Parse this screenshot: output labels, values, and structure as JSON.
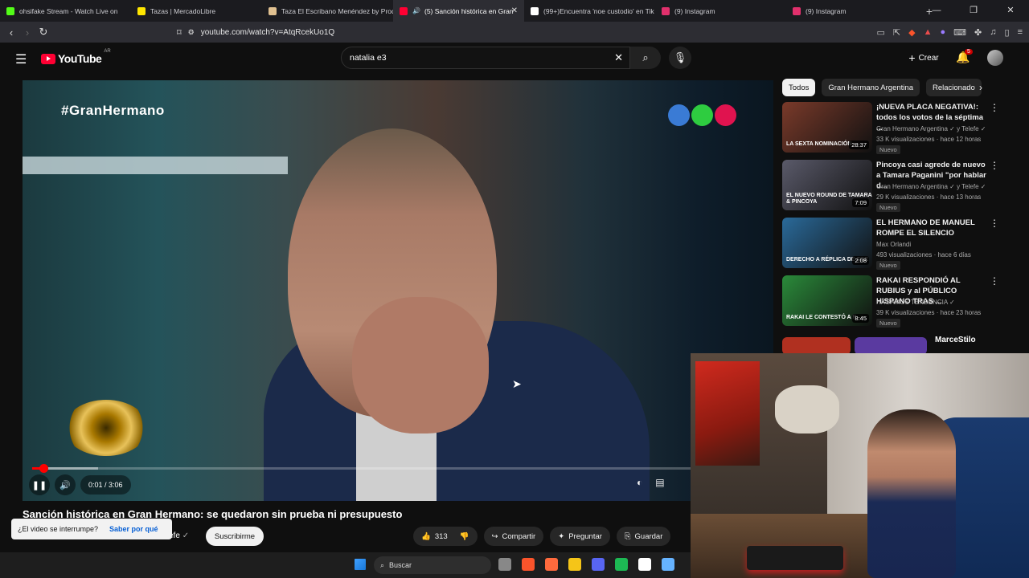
{
  "browser": {
    "tabs": [
      {
        "title": "ohsifake Stream - Watch Live on",
        "color": "#53fc18"
      },
      {
        "title": "Tazas | MercadoLibre",
        "color": "#ffe600"
      },
      {
        "title": "Taza El Escribano Menéndez by Prod",
        "color": "#e0c090"
      },
      {
        "title": "(5) Sanción histórica en Gran",
        "color": "#ff0033",
        "active": true
      },
      {
        "title": "(99+)Encuentra 'noe custodio' en Tik",
        "color": "#ffffff"
      },
      {
        "title": "(9) Instagram",
        "color": "#e1306c"
      },
      {
        "title": "(9) Instagram",
        "color": "#e1306c"
      }
    ],
    "new_tab": "+",
    "url": "youtube.com/watch?v=AtqRcekUo1Q"
  },
  "header": {
    "logo_text": "YouTube",
    "country": "AR",
    "search_value": "natalia e3",
    "create_label": "Crear",
    "notification_count": "5"
  },
  "player": {
    "overlay_tag": "#GranHermano",
    "time": "0:01 / 3:06",
    "progress_fraction": 0.01,
    "buffered_fraction": 0.09,
    "dot_colors": [
      "#3a7bd5",
      "#2ecc40",
      "#e0134f"
    ]
  },
  "video": {
    "title": "Sanción histórica en Gran Hermano: se quedaron sin prueba ni presupuesto",
    "channel_partial": "efe",
    "subscribe_label": "Suscribirme",
    "likes": "313",
    "share_label": "Compartir",
    "ask_label": "Preguntar",
    "save_label": "Guardar"
  },
  "toast": {
    "question": "¿El video se interrumpe?",
    "link": "Saber por qué"
  },
  "sidebar": {
    "chips": [
      "Todos",
      "Gran Hermano Argentina",
      "Relacionado"
    ],
    "recommendations": [
      {
        "title": "¡NUEVA PLACA NEGATIVA!: todos los votos de la séptima ...",
        "channel": "Gran Hermano Argentina ✓ y Telefe ✓",
        "meta": "33 K visualizaciones · hace 12 horas",
        "badge": "Nuevo",
        "duration": "28:37",
        "overlay": "LA SEXTA NOMINACIÓN",
        "thumb_color": "#7a3a2a"
      },
      {
        "title": "Pincoya casi agrede de nuevo a Tamara Paganini \"por hablar d...",
        "channel": "Gran Hermano Argentina ✓ y Telefe ✓",
        "meta": "29 K visualizaciones · hace 13 horas",
        "badge": "Nuevo",
        "duration": "7:09",
        "overlay": "EL NUEVO ROUND DE TAMARA & PINCOYA",
        "thumb_color": "#5a5a6a"
      },
      {
        "title": "EL HERMANO DE MANUEL ROMPE EL SILENCIO",
        "channel": "Max Orlandi",
        "meta": "493 visualizaciones · hace 6 días",
        "badge": "Nuevo",
        "duration": "2:08",
        "overlay": "DERECHO A RÉPLICA DE ZOE",
        "thumb_color": "#2a6a9a"
      },
      {
        "title": "RAKAI RESPONDIÓ AL RUBIUS y al PÚBLICO HISPANO TRAS ...",
        "channel": "HAGAMOS TENDENCIA ✓",
        "meta": "39 K visualizaciones · hace 23 horas",
        "badge": "Nuevo",
        "duration": "8:45",
        "overlay": "RAKAI LE CONTESTÓ A R",
        "thumb_color": "#2a8a3a"
      }
    ],
    "partial_title": "MarceStilo"
  },
  "taskbar": {
    "search_placeholder": "Buscar",
    "icon_colors": [
      "#888888",
      "#fb542b",
      "#ff6a3d",
      "#f5c518",
      "#5865f2",
      "#1db954",
      "#ffffff",
      "#66b3ff"
    ]
  }
}
